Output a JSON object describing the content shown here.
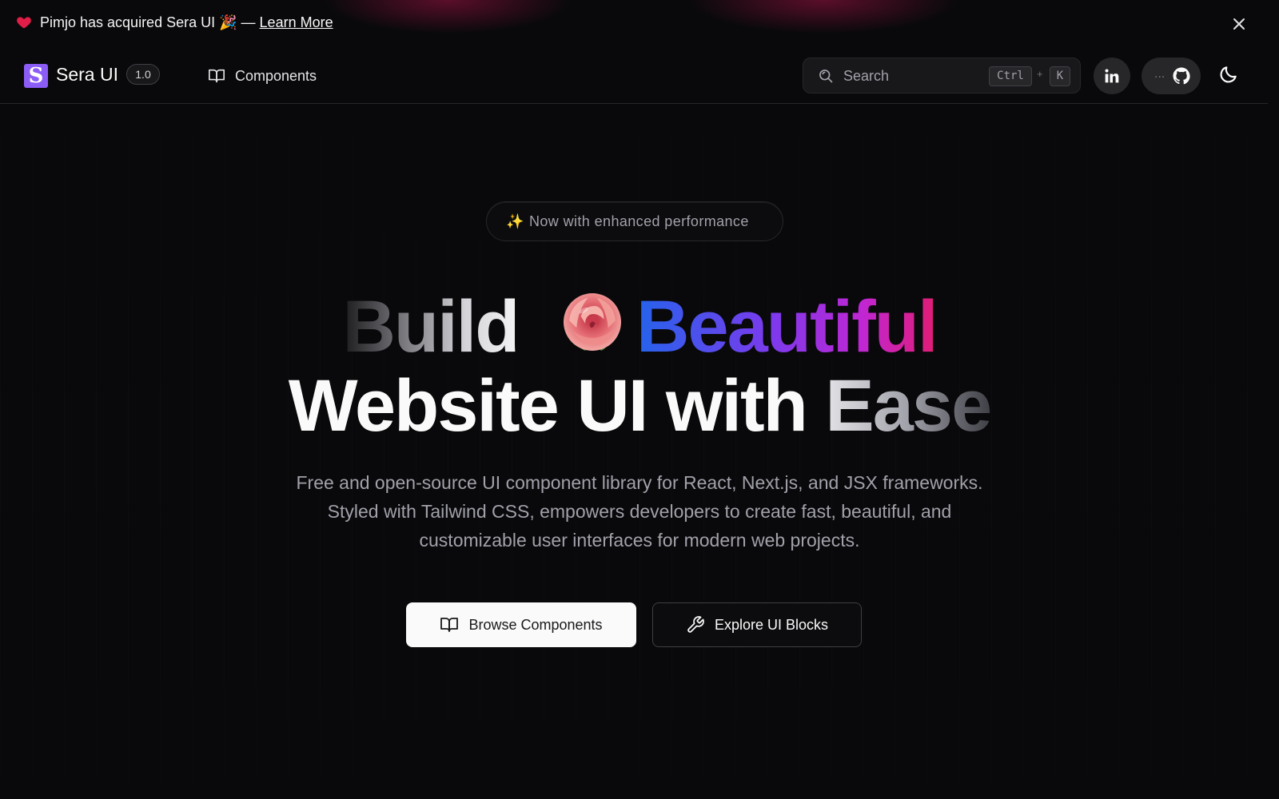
{
  "announcement": {
    "text": "Pimjo has acquired Sera UI 🎉 —",
    "link_label": "Learn More",
    "heart_icon": "heart-icon",
    "close_icon": "close-icon"
  },
  "nav": {
    "logo_letter": "S",
    "brand": "Sera UI",
    "version": "1.0",
    "components_label": "Components",
    "search": {
      "placeholder": "Search",
      "shortcut_ctrl": "Ctrl",
      "shortcut_plus": "+",
      "shortcut_key": "K"
    },
    "github_prefix": "...",
    "icons": [
      "book-icon",
      "search-icon",
      "linkedin-icon",
      "github-icon",
      "moon-icon"
    ]
  },
  "hero": {
    "badge_spark": "✨",
    "badge_text": "Now with enhanced performance",
    "headline_word1": "Build",
    "headline_word2": "Beautiful",
    "headline_line2_main": "Website UI with ",
    "headline_line2_fade": "Ease",
    "subtitle": "Free and open-source UI component library for React, Next.js, and JSX frameworks. Styled with Tailwind CSS, empowers developers to create fast, beautiful, and customizable user interfaces for modern web projects.",
    "primary_button": "Browse Components",
    "secondary_button": "Explore UI Blocks"
  },
  "colors": {
    "background": "#09090b",
    "brand_purple": "#8b5cf6",
    "gradient_blue": "#2563eb",
    "gradient_purple": "#7c3aed",
    "gradient_pink": "#e11d74",
    "heart_red": "#e11d48"
  }
}
